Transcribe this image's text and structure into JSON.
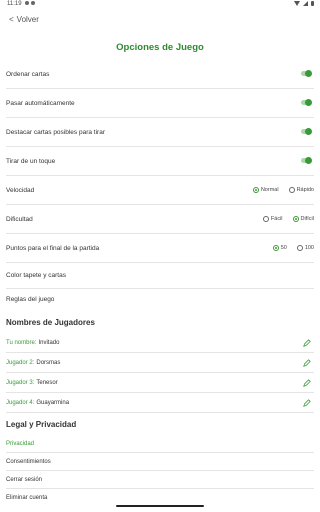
{
  "status": {
    "time": "11:19"
  },
  "nav": {
    "back_label": "Volver"
  },
  "title": "Opciones de Juego",
  "toggles": [
    {
      "label": "Ordenar cartas",
      "on": true
    },
    {
      "label": "Pasar automáticamente",
      "on": true
    },
    {
      "label": "Destacar cartas posibles para tirar",
      "on": true
    },
    {
      "label": "Tirar de un toque",
      "on": true
    }
  ],
  "speed": {
    "label": "Velocidad",
    "options": [
      "Normal",
      "Rápido"
    ],
    "selected": "Normal"
  },
  "difficulty": {
    "label": "Dificultad",
    "options": [
      "Fácil",
      "Difícil"
    ],
    "selected": "Difícil"
  },
  "points": {
    "label": "Puntos para el final de la partida",
    "options": [
      "50",
      "100"
    ],
    "selected": "50"
  },
  "links": {
    "table_color": "Color tapete y cartas",
    "rules": "Reglas del juego"
  },
  "players": {
    "heading": "Nombres de Jugadores",
    "items": [
      {
        "key": "Tu nombre:",
        "name": "Invitado"
      },
      {
        "key": "Jugador 2:",
        "name": "Dorsmas"
      },
      {
        "key": "Jugador 3:",
        "name": "Tenesor"
      },
      {
        "key": "Jugador 4:",
        "name": "Guayarmina"
      }
    ]
  },
  "legal": {
    "heading": "Legal y Privacidad",
    "items": [
      "Privacidad",
      "Consentimientos",
      "Cerrar sesión",
      "Eliminar cuenta"
    ]
  },
  "colors": {
    "accent": "#3a9a3a",
    "title": "#2e8b2e",
    "toggle_track": "#a9d8a9"
  }
}
